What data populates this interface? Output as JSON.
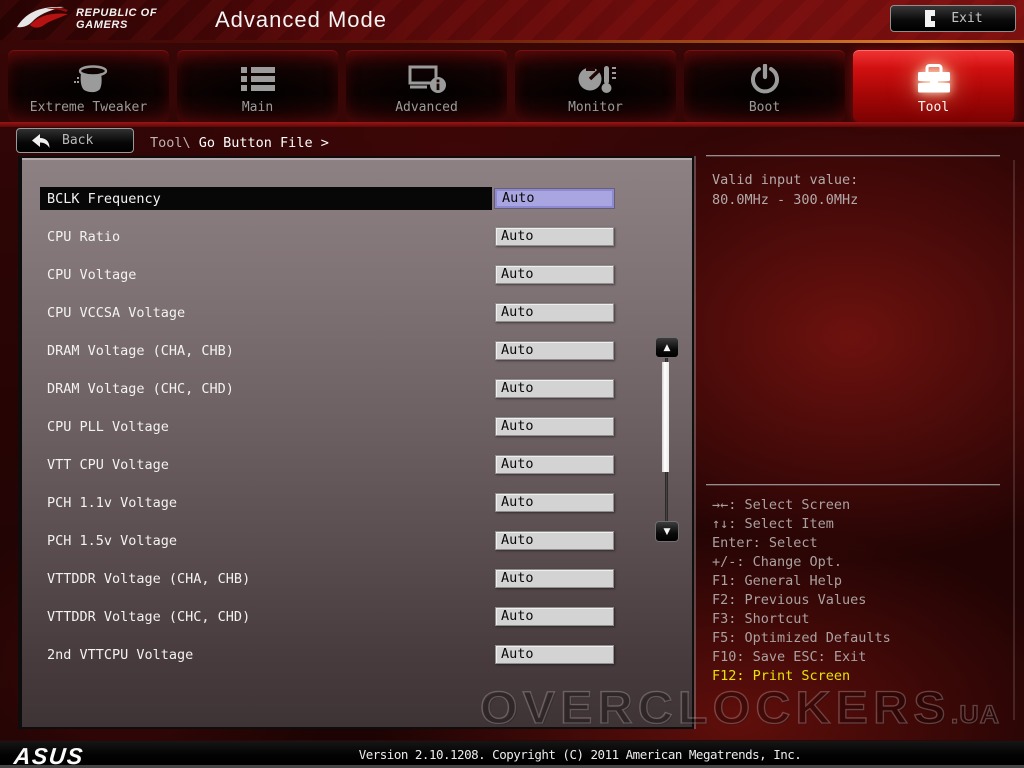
{
  "header": {
    "brand_line1": "REPUBLIC OF",
    "brand_line2": "GAMERS",
    "title": "Advanced Mode",
    "exit_label": "Exit"
  },
  "tabs": [
    {
      "label": "Extreme Tweaker",
      "icon": "tweaker-dial-icon",
      "active": false
    },
    {
      "label": "Main",
      "icon": "list-icon",
      "active": false
    },
    {
      "label": "Advanced",
      "icon": "monitor-info-icon",
      "active": false
    },
    {
      "label": "Monitor",
      "icon": "gauge-thermometer-icon",
      "active": false
    },
    {
      "label": "Boot",
      "icon": "power-icon",
      "active": false
    },
    {
      "label": "Tool",
      "icon": "toolbox-icon",
      "active": true
    }
  ],
  "nav": {
    "back_label": "Back",
    "breadcrumb_root": "Tool\\",
    "breadcrumb_path": "Go Button File >"
  },
  "settings": {
    "rows": [
      {
        "label": "BCLK Frequency",
        "value": "Auto",
        "selected": true
      },
      {
        "label": "CPU Ratio",
        "value": "Auto",
        "selected": false
      },
      {
        "label": "CPU Voltage",
        "value": "Auto",
        "selected": false
      },
      {
        "label": "CPU VCCSA Voltage",
        "value": "Auto",
        "selected": false
      },
      {
        "label": "DRAM Voltage (CHA, CHB)",
        "value": "Auto",
        "selected": false
      },
      {
        "label": "DRAM Voltage (CHC, CHD)",
        "value": "Auto",
        "selected": false
      },
      {
        "label": "CPU PLL Voltage",
        "value": "Auto",
        "selected": false
      },
      {
        "label": "VTT CPU Voltage",
        "value": "Auto",
        "selected": false
      },
      {
        "label": "PCH 1.1v Voltage",
        "value": "Auto",
        "selected": false
      },
      {
        "label": "PCH 1.5v Voltage",
        "value": "Auto",
        "selected": false
      },
      {
        "label": "VTTDDR Voltage (CHA, CHB)",
        "value": "Auto",
        "selected": false
      },
      {
        "label": "VTTDDR Voltage (CHC, CHD)",
        "value": "Auto",
        "selected": false
      },
      {
        "label": "2nd VTTCPU Voltage",
        "value": "Auto",
        "selected": false
      }
    ]
  },
  "info_panel": {
    "line1": "Valid input value:",
    "line2": "80.0MHz - 300.0MHz"
  },
  "help_keys": [
    {
      "text": "→←: Select Screen",
      "highlight": false
    },
    {
      "text": "↑↓: Select Item",
      "highlight": false
    },
    {
      "text": "Enter: Select",
      "highlight": false
    },
    {
      "text": "+/-: Change Opt.",
      "highlight": false
    },
    {
      "text": "F1: General Help",
      "highlight": false
    },
    {
      "text": "F2: Previous Values",
      "highlight": false
    },
    {
      "text": "F3: Shortcut",
      "highlight": false
    },
    {
      "text": "F5: Optimized Defaults",
      "highlight": false
    },
    {
      "text": "F10: Save  ESC: Exit",
      "highlight": false
    },
    {
      "text": "F12: Print Screen",
      "highlight": true
    }
  ],
  "scrollbar": {
    "up_glyph": "▲",
    "down_glyph": "▼"
  },
  "watermark": {
    "text": "OVERCLOCKERS",
    "suffix": ".UA"
  },
  "footer": {
    "logo": "ASUS",
    "version": "Version 2.10.1208. Copyright (C) 2011 American Megatrends, Inc."
  },
  "colors": {
    "accent_red": "#cc0e0e",
    "active_tab_red": "#d01010",
    "selected_field": "#a9a5e0",
    "field_gray": "#d3d3d3",
    "highlight_yellow": "#e8e400",
    "panel_mauve_top": "#8e8183",
    "panel_mauve_bottom": "#3e3335"
  }
}
